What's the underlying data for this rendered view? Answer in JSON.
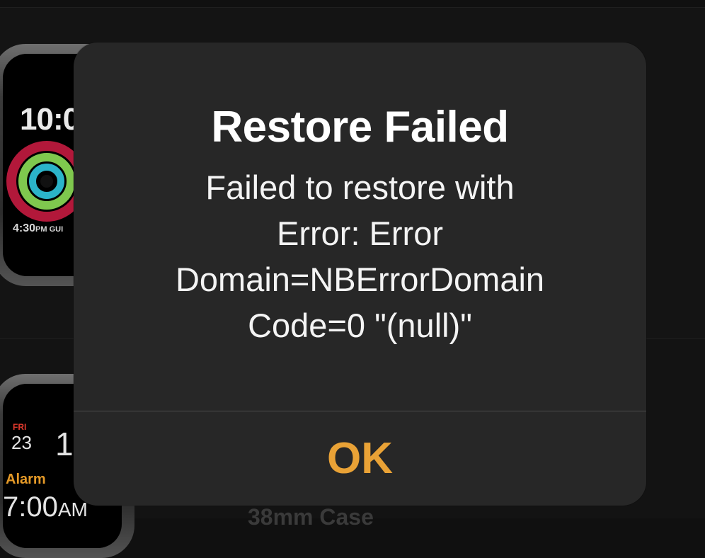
{
  "alert": {
    "title": "Restore Failed",
    "message_lines": [
      "Failed to restore with",
      "Error: Error",
      "Domain=NBErrorDomain",
      "Code=0 \"(null)\""
    ],
    "primary_button_label": "OK"
  },
  "background": {
    "watch_top": {
      "time_visible": "10:0",
      "gui_time_main": "4:30",
      "gui_time_suffix": "PM GUI"
    },
    "watch_bottom": {
      "day": "FRI",
      "date": "23",
      "big_number": "1",
      "alarm_label": "Alarm",
      "alarm_time": "7:00",
      "alarm_ampm": "AM"
    },
    "hidden_text": "38mm Case"
  }
}
